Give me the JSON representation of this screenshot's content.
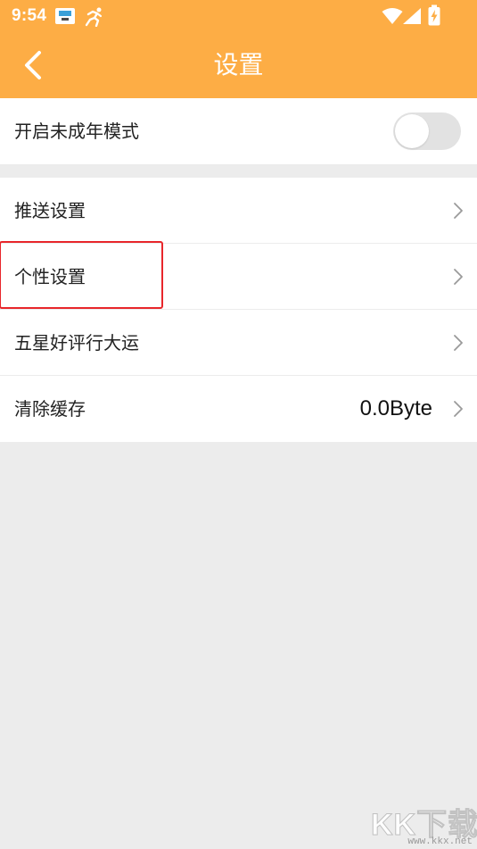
{
  "status_bar": {
    "time": "9:54",
    "icons": [
      "keyboard-notification-icon",
      "running-figure-icon",
      "wifi-icon",
      "signal-icon",
      "battery-charging-icon"
    ]
  },
  "header": {
    "title": "设置",
    "back_icon": "chevron-left-icon"
  },
  "colors": {
    "header": "#fdad45",
    "background": "#ececec",
    "row_background": "#ffffff",
    "highlight": "#e8262b"
  },
  "sections": [
    {
      "rows": [
        {
          "label": "开启未成年模式",
          "control": "toggle",
          "checked": false
        }
      ]
    },
    {
      "rows": [
        {
          "label": "推送设置",
          "control": "chevron-right-icon"
        },
        {
          "label": "个性设置",
          "control": "chevron-right-icon",
          "highlighted": true
        },
        {
          "label": "五星好评行大运",
          "control": "chevron-right-icon"
        },
        {
          "label": "清除缓存",
          "value": "0.0Byte",
          "control": "chevron-right-icon"
        }
      ]
    }
  ],
  "watermark": {
    "logo": "KK下载",
    "url": "www.kkx.net"
  }
}
